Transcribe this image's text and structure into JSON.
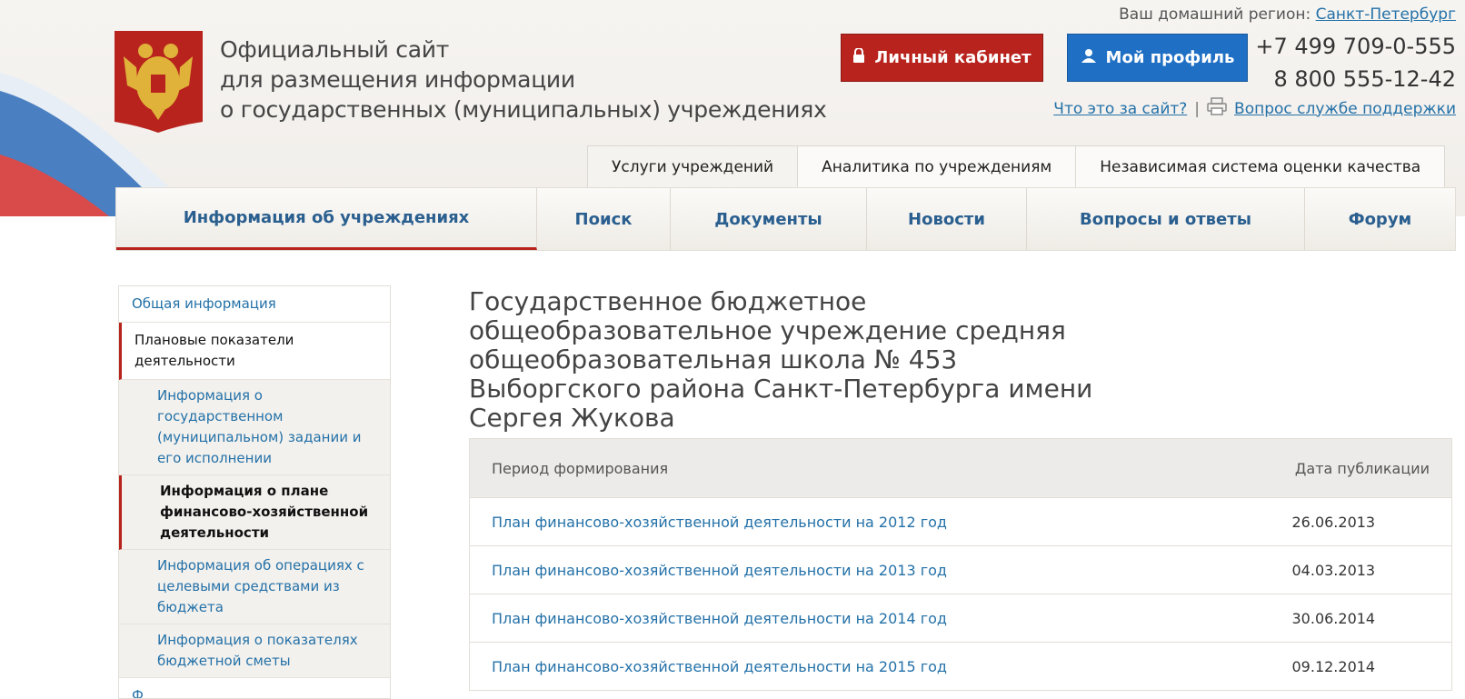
{
  "header": {
    "title_lines": [
      "Официальный сайт",
      "для размещения информации",
      "о государственных (муниципальных) учреждениях"
    ],
    "region_label": "Ваш домашний регион:",
    "region_value": "Санкт-Петербург",
    "cabinet_button": "Личный кабинет",
    "profile_button": "Мой профиль",
    "phone1": "+7 499 709-0-555",
    "phone2": "8 800 555-12-42",
    "what_is_link": "Что это за сайт?",
    "separator": "|",
    "support_link": "Вопрос службе поддержки"
  },
  "top_tabs": [
    {
      "label": "Услуги учреждений"
    },
    {
      "label": "Аналитика по учреждениям"
    },
    {
      "label": "Независимая система оценки качества"
    }
  ],
  "main_nav": [
    {
      "label": "Информация об учреждениях"
    },
    {
      "label": "Поиск"
    },
    {
      "label": "Документы"
    },
    {
      "label": "Новости"
    },
    {
      "label": "Вопросы и ответы"
    },
    {
      "label": "Форум"
    }
  ],
  "sidebar": {
    "items": [
      {
        "label": "Общая информация"
      },
      {
        "label": "Плановые показатели деятельности"
      },
      {
        "label": "Информация о государственном (муниципальном) задании и его исполнении"
      },
      {
        "label": "Информация о плане финансово-хозяйственной деятельности"
      },
      {
        "label": "Информация об операциях с целевыми средствами из бюджета"
      },
      {
        "label": "Информация о показателях бюджетной сметы"
      },
      {
        "label": "Ф..."
      }
    ]
  },
  "content": {
    "title": "Государственное бюджетное общеобразовательное учреждение средняя общеобразовательная школа № 453 Выборгского района Санкт-Петербурга имени Сергея Жукова",
    "table": {
      "col_period": "Период формирования",
      "col_date": "Дата публикации",
      "rows": [
        {
          "period": "План финансово-хозяйственной деятельности на 2012 год",
          "date": "26.06.2013"
        },
        {
          "period": "План финансово-хозяйственной деятельности на 2013 год",
          "date": "04.03.2013"
        },
        {
          "period": "План финансово-хозяйственной деятельности на 2014 год",
          "date": "30.06.2014"
        },
        {
          "period": "План финансово-хозяйственной деятельности на 2015 год",
          "date": "09.12.2014"
        }
      ]
    }
  },
  "colors": {
    "accent_red": "#b8231d",
    "accent_blue": "#1f6fc4",
    "link": "#2471a8"
  }
}
